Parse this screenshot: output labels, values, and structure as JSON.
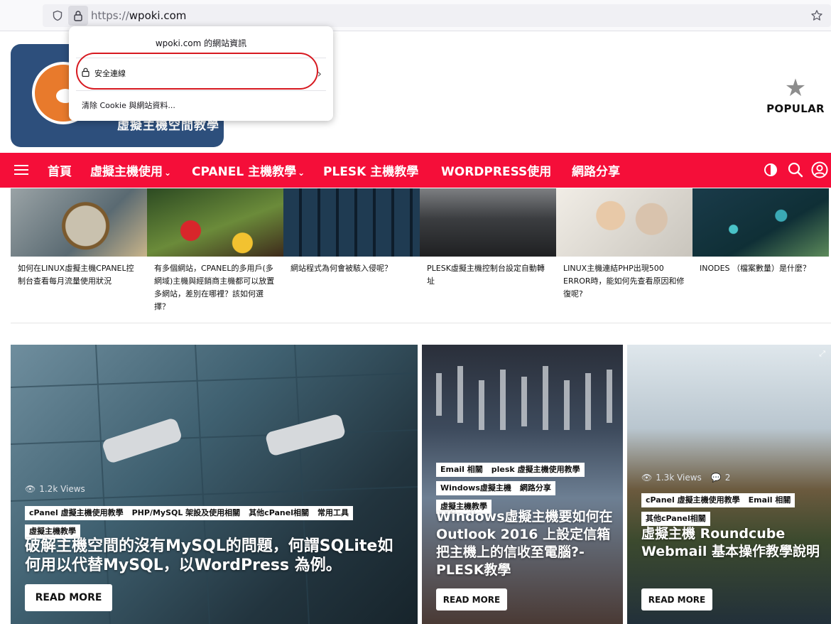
{
  "browser": {
    "url_protocol": "https://",
    "url_host": "wpoki.com",
    "icons": [
      "shield-icon",
      "lock-icon",
      "star-icon"
    ]
  },
  "site_info_popup": {
    "title": "wpoki.com 的網站資訊",
    "secure_connection": "安全連線",
    "clear_cookies": "清除 Cookie 與網站資料..."
  },
  "header": {
    "logo_text": "虛擬主機空間教學",
    "popular_label": "POPULAR",
    "colors": {
      "logo_bg": "#2d4f7c",
      "mascot": "#e87a2c"
    }
  },
  "nav": {
    "items": [
      {
        "label": "首頁",
        "has_dropdown": false
      },
      {
        "label": "虛擬主機使用",
        "has_dropdown": true
      },
      {
        "label": "CPANEL 主機教學",
        "has_dropdown": true
      },
      {
        "label": "PLESK 主機教學",
        "has_dropdown": false
      },
      {
        "label": "WORDPRESS使用",
        "has_dropdown": false
      },
      {
        "label": "網路分享",
        "has_dropdown": false
      }
    ],
    "color": "#f50e39",
    "right_icons": [
      "dark-mode-icon",
      "search-icon",
      "user-icon"
    ]
  },
  "thumbs": [
    {
      "title": "如何在LINUX虛擬主機CPANEL控制台查看每月流量使用狀況"
    },
    {
      "title": "有多個網站，CPANEL的多用戶(多網域)主機與經銷商主機都可以放置多網站，差別在哪裡？該如何選擇？"
    },
    {
      "title": "網站程式為何會被駭入侵呢？"
    },
    {
      "title": "PLESK虛擬主機控制台設定自動轉址"
    },
    {
      "title": "LINUX主機連結PHP出現500 ERROR時，能如何先查看原因和修復呢?"
    },
    {
      "title": "INODES （檔案數量）是什麼？"
    }
  ],
  "featured": [
    {
      "views": "1.2k Views",
      "tags": [
        "cPanel 虛擬主機使用教學",
        "PHP/MySQL 架設及使用相關",
        "其他cPanel相關",
        "常用工具",
        "虛擬主機教學"
      ],
      "title": "破解主機空間的沒有MySQL的問題，何謂SQLite如何用以代替MySQL，以WordPress 為例。",
      "read_more": "READ MORE"
    },
    {
      "tags": [
        "Email 相關",
        "plesk 虛擬主機使用教學",
        "Windows虛擬主機",
        "網路分享",
        "虛擬主機教學"
      ],
      "title": "Windows虛擬主機要如何在 Outlook 2016 上設定信箱把主機上的信收至電腦?-PLESK教學",
      "read_more": "READ MORE"
    },
    {
      "views": "1.3k Views",
      "comments": "2",
      "tags": [
        "cPanel 虛擬主機使用教學",
        "Email 相關",
        "其他cPanel相關"
      ],
      "title": "虛擬主機 Roundcube Webmail 基本操作教學說明",
      "read_more": "READ MORE"
    }
  ]
}
